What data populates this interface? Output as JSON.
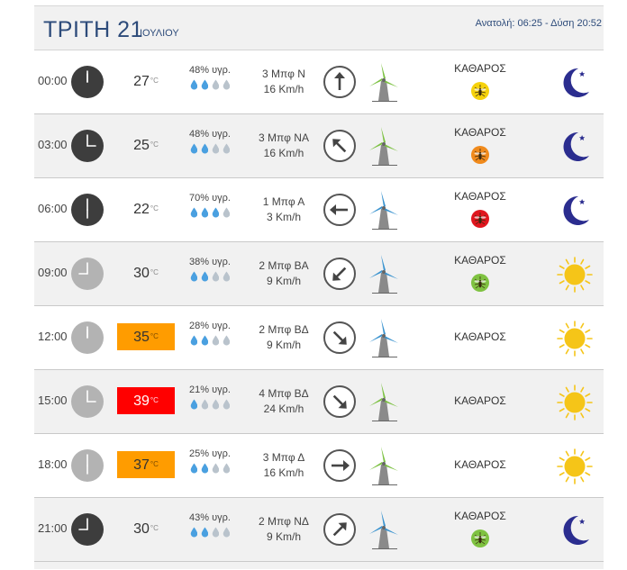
{
  "header": {
    "day": "ΤΡΙΤΗ 21",
    "month": "ΙΟΥΛΙΟΥ",
    "sun": "Ανατολή: 06:25 - Δύση 20:52"
  },
  "colors": {
    "title": "#2d4b7a",
    "hot": "#ff9c00",
    "very_hot": "#ff0000",
    "drop_filled": "#4aa0e0",
    "drop_empty": "#b9c3cc",
    "mill_green": "#7cc142",
    "mill_blue": "#3a93cf",
    "moon": "#2b2d8f",
    "sun": "#f5c518"
  },
  "temp_unit": "°C",
  "rows": [
    {
      "time": "00:00",
      "clock": "dark",
      "temp": "27",
      "heat": "normal",
      "humidity": "48% υγρ.",
      "drops": 2,
      "wind_bft": "3 Μπφ Ν",
      "wind_speed": "16 Km/h",
      "arrow_icon": "arrow-up-icon",
      "arrow_deg": 0,
      "mill_color": "green",
      "condition": "ΚΑΘΑΡΟΣ",
      "mosquito": "yellow",
      "weather_icon": "moon-icon"
    },
    {
      "time": "03:00",
      "clock": "dark",
      "temp": "25",
      "heat": "normal",
      "humidity": "48% υγρ.",
      "drops": 2,
      "wind_bft": "3 Μπφ ΝΑ",
      "wind_speed": "16 Km/h",
      "arrow_icon": "arrow-up-left-icon",
      "arrow_deg": -45,
      "mill_color": "green",
      "condition": "ΚΑΘΑΡΟΣ",
      "mosquito": "orange",
      "weather_icon": "moon-icon"
    },
    {
      "time": "06:00",
      "clock": "dark",
      "temp": "22",
      "heat": "normal",
      "humidity": "70% υγρ.",
      "drops": 3,
      "wind_bft": "1 Μπφ Α",
      "wind_speed": "3 Km/h",
      "arrow_icon": "arrow-left-icon",
      "arrow_deg": -90,
      "mill_color": "blue",
      "condition": "ΚΑΘΑΡΟΣ",
      "mosquito": "red",
      "weather_icon": "moon-icon"
    },
    {
      "time": "09:00",
      "clock": "light",
      "temp": "30",
      "heat": "normal",
      "humidity": "38% υγρ.",
      "drops": 2,
      "wind_bft": "2 Μπφ ΒΑ",
      "wind_speed": "9 Km/h",
      "arrow_icon": "arrow-down-left-icon",
      "arrow_deg": -135,
      "mill_color": "blue",
      "condition": "ΚΑΘΑΡΟΣ",
      "mosquito": "green",
      "weather_icon": "sun-icon"
    },
    {
      "time": "12:00",
      "clock": "light",
      "temp": "35",
      "heat": "hot",
      "humidity": "28% υγρ.",
      "drops": 2,
      "wind_bft": "2 Μπφ ΒΔ",
      "wind_speed": "9 Km/h",
      "arrow_icon": "arrow-down-right-icon",
      "arrow_deg": 135,
      "mill_color": "blue",
      "condition": "ΚΑΘΑΡΟΣ",
      "mosquito": "none",
      "weather_icon": "sun-icon"
    },
    {
      "time": "15:00",
      "clock": "light",
      "temp": "39",
      "heat": "very-hot",
      "humidity": "21% υγρ.",
      "drops": 1,
      "wind_bft": "4 Μπφ ΒΔ",
      "wind_speed": "24 Km/h",
      "arrow_icon": "arrow-down-right-icon",
      "arrow_deg": 135,
      "mill_color": "green",
      "condition": "ΚΑΘΑΡΟΣ",
      "mosquito": "none",
      "weather_icon": "sun-icon"
    },
    {
      "time": "18:00",
      "clock": "light",
      "temp": "37",
      "heat": "hot",
      "humidity": "25% υγρ.",
      "drops": 2,
      "wind_bft": "3 Μπφ Δ",
      "wind_speed": "16 Km/h",
      "arrow_icon": "arrow-right-icon",
      "arrow_deg": 90,
      "mill_color": "green",
      "condition": "ΚΑΘΑΡΟΣ",
      "mosquito": "none",
      "weather_icon": "sun-icon"
    },
    {
      "time": "21:00",
      "clock": "dark",
      "temp": "30",
      "heat": "normal",
      "humidity": "43% υγρ.",
      "drops": 2,
      "wind_bft": "2 Μπφ ΝΔ",
      "wind_speed": "9 Km/h",
      "arrow_icon": "arrow-up-right-icon",
      "arrow_deg": 45,
      "mill_color": "blue",
      "condition": "ΚΑΘΑΡΟΣ",
      "mosquito": "green",
      "weather_icon": "moon-icon"
    }
  ]
}
